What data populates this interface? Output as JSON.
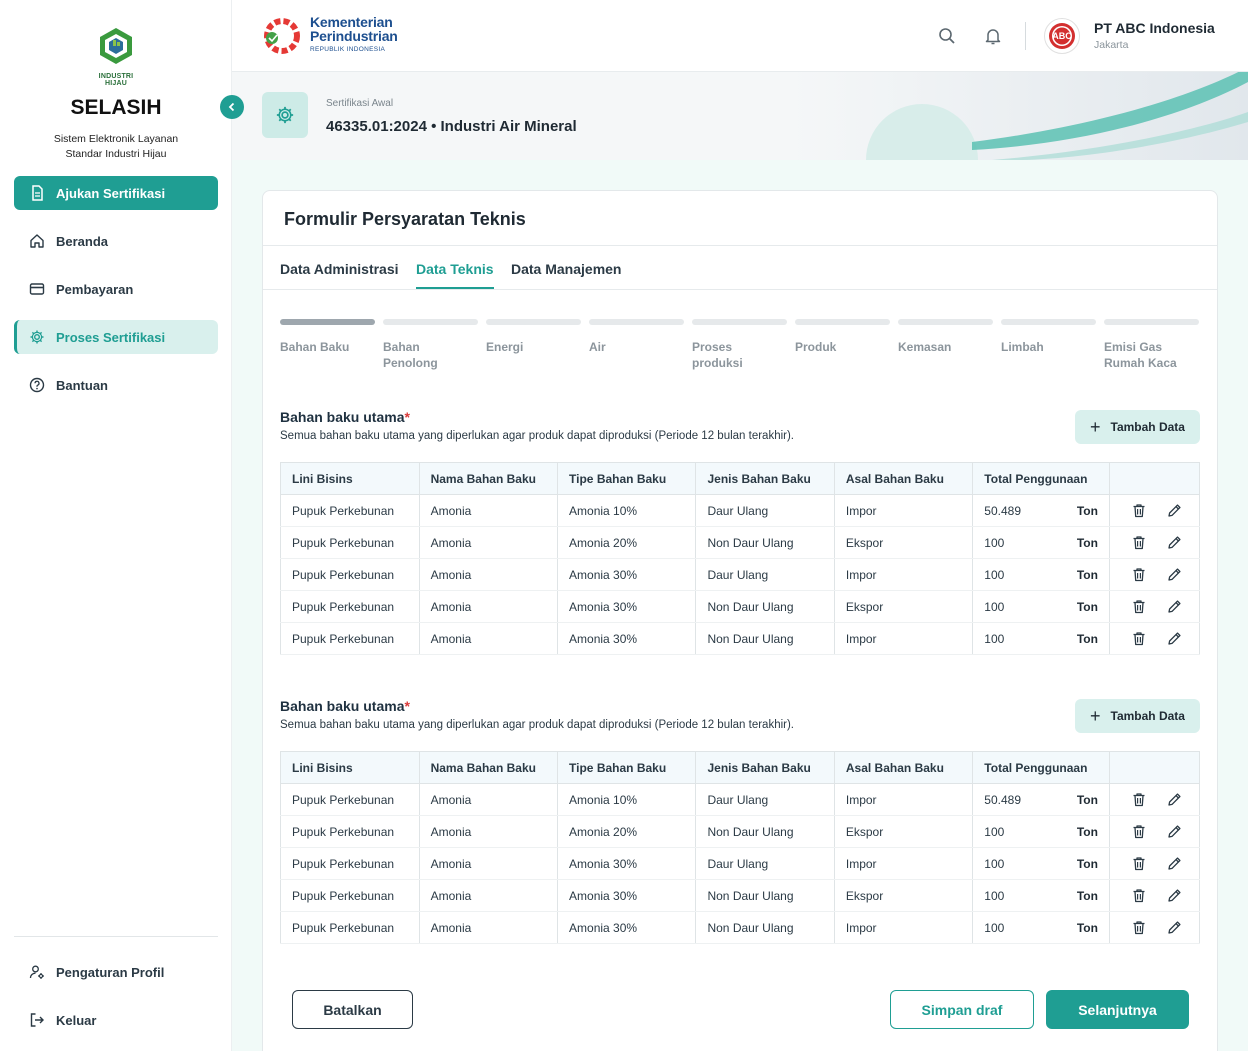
{
  "sidebar": {
    "logo_caption": "INDUSTRI HIJAU",
    "app_title": "SELASIH",
    "app_subtitle_line1": "Sistem Elektronik Layanan",
    "app_subtitle_line2": "Standar Industri Hijau",
    "items": [
      {
        "label": "Ajukan Sertifikasi",
        "icon": "document-icon"
      },
      {
        "label": "Beranda",
        "icon": "home-icon"
      },
      {
        "label": "Pembayaran",
        "icon": "card-icon"
      },
      {
        "label": "Proses Sertifikasi",
        "icon": "gear-icon"
      },
      {
        "label": "Bantuan",
        "icon": "help-icon"
      }
    ],
    "footer_items": [
      {
        "label": "Pengaturan Profil",
        "icon": "user-settings-icon"
      },
      {
        "label": "Keluar",
        "icon": "logout-icon"
      }
    ]
  },
  "header": {
    "ministry_line1": "Kementerian",
    "ministry_line2": "Perindustrian",
    "ministry_line3": "REPUBLIK INDONESIA",
    "company_logo_text": "ABC",
    "company_name": "PT ABC Indonesia",
    "company_city": "Jakarta"
  },
  "banner": {
    "label": "Sertifikasi Awal",
    "title": "46335.01:2024 • Industri Air Mineral"
  },
  "form": {
    "title": "Formulir Persyaratan Teknis",
    "tabs": [
      "Data Administrasi",
      "Data Teknis",
      "Data Manajemen"
    ],
    "active_tab": 1,
    "steps": [
      {
        "line1": "Bahan Baku",
        "line2": ""
      },
      {
        "line1": "Bahan",
        "line2": "Penolong"
      },
      {
        "line1": "Energi",
        "line2": ""
      },
      {
        "line1": "Air",
        "line2": ""
      },
      {
        "line1": "Proses",
        "line2": "produksi"
      },
      {
        "line1": "Produk",
        "line2": ""
      },
      {
        "line1": "Kemasan",
        "line2": ""
      },
      {
        "line1": "Limbah",
        "line2": ""
      },
      {
        "line1": "Emisi Gas",
        "line2": "Rumah Kaca"
      }
    ],
    "active_step": 0,
    "sections": [
      {
        "title": "Bahan baku utama",
        "required_mark": "*",
        "description": "Semua bahan baku utama yang diperlukan agar produk dapat diproduksi (Periode 12 bulan terakhir).",
        "add_label": "Tambah Data",
        "columns": [
          "Lini Bisins",
          "Nama Bahan Baku",
          "Tipe Bahan Baku",
          "Jenis Bahan Baku",
          "Asal Bahan Baku",
          "Total Penggunaan"
        ],
        "rows": [
          [
            "Pupuk Perkebunan",
            "Amonia",
            "Amonia 10%",
            "Daur Ulang",
            "Impor",
            "50.489",
            "Ton"
          ],
          [
            "Pupuk Perkebunan",
            "Amonia",
            "Amonia 20%",
            "Non Daur Ulang",
            "Ekspor",
            "100",
            "Ton"
          ],
          [
            "Pupuk Perkebunan",
            "Amonia",
            "Amonia 30%",
            "Daur Ulang",
            "Impor",
            "100",
            "Ton"
          ],
          [
            "Pupuk Perkebunan",
            "Amonia",
            "Amonia 30%",
            "Non Daur Ulang",
            "Ekspor",
            "100",
            "Ton"
          ],
          [
            "Pupuk Perkebunan",
            "Amonia",
            "Amonia 30%",
            "Non Daur Ulang",
            "Impor",
            "100",
            "Ton"
          ]
        ]
      },
      {
        "title": "Bahan baku utama",
        "required_mark": "*",
        "description": "Semua bahan baku utama yang diperlukan agar produk dapat diproduksi (Periode 12 bulan terakhir).",
        "add_label": "Tambah Data",
        "columns": [
          "Lini Bisins",
          "Nama Bahan Baku",
          "Tipe Bahan Baku",
          "Jenis Bahan Baku",
          "Asal Bahan Baku",
          "Total Penggunaan"
        ],
        "rows": [
          [
            "Pupuk Perkebunan",
            "Amonia",
            "Amonia 10%",
            "Daur Ulang",
            "Impor",
            "50.489",
            "Ton"
          ],
          [
            "Pupuk Perkebunan",
            "Amonia",
            "Amonia 20%",
            "Non Daur Ulang",
            "Ekspor",
            "100",
            "Ton"
          ],
          [
            "Pupuk Perkebunan",
            "Amonia",
            "Amonia 30%",
            "Daur Ulang",
            "Impor",
            "100",
            "Ton"
          ],
          [
            "Pupuk Perkebunan",
            "Amonia",
            "Amonia 30%",
            "Non Daur Ulang",
            "Ekspor",
            "100",
            "Ton"
          ],
          [
            "Pupuk Perkebunan",
            "Amonia",
            "Amonia 30%",
            "Non Daur Ulang",
            "Impor",
            "100",
            "Ton"
          ]
        ]
      }
    ],
    "buttons": {
      "cancel": "Batalkan",
      "draft": "Simpan draf",
      "next": "Selanjutnya"
    }
  },
  "colors": {
    "accent": "#1f9e93",
    "accent_light": "#d9f0ed",
    "required": "#d93a3a"
  }
}
